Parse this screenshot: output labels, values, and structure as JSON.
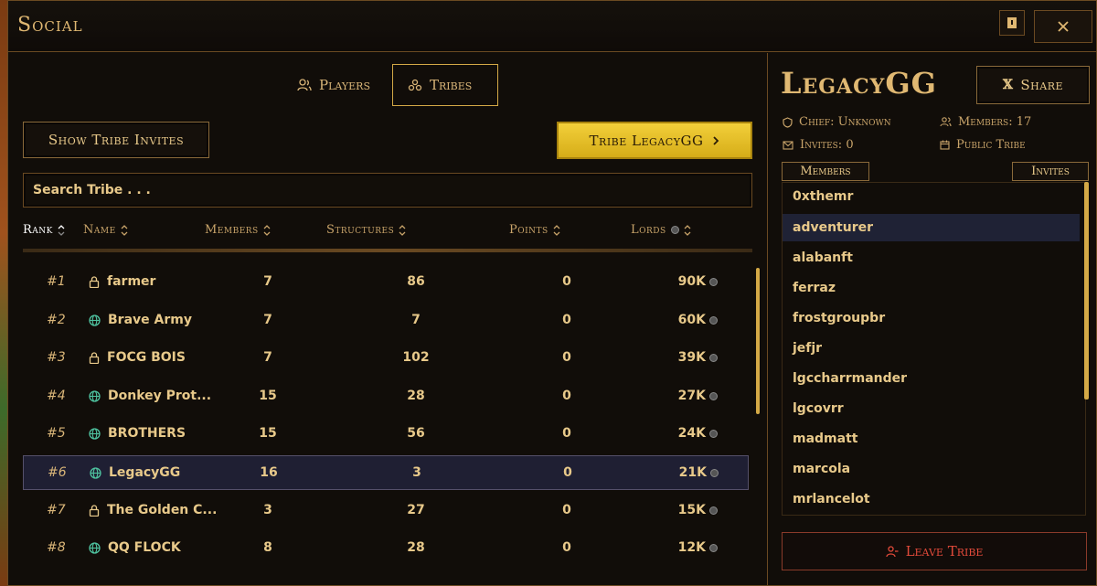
{
  "window": {
    "title": "Social"
  },
  "tabs": [
    {
      "label": "Players",
      "icon": "users-icon"
    },
    {
      "label": "Tribes",
      "icon": "tribes-icon",
      "active": true
    }
  ],
  "actions": {
    "show_invites": "Show Tribe Invites",
    "tribe_button": "Tribe LegacyGG",
    "search_placeholder": "Search Tribe . . ."
  },
  "table": {
    "columns": [
      "Rank",
      "Name",
      "Members",
      "Structures",
      "Points",
      "Lords"
    ],
    "sorted_by": "Rank",
    "rows": [
      {
        "rank": "#1",
        "name": "farmer",
        "visibility": "lock-icon",
        "members": "7",
        "structures": "86",
        "points": "0",
        "lords": "90K"
      },
      {
        "rank": "#2",
        "name": "Brave Army",
        "visibility": "globe-icon",
        "members": "7",
        "structures": "7",
        "points": "0",
        "lords": "60K"
      },
      {
        "rank": "#3",
        "name": "FOCG BOIS",
        "visibility": "lock-icon",
        "members": "7",
        "structures": "102",
        "points": "0",
        "lords": "39K"
      },
      {
        "rank": "#4",
        "name": "Donkey Prot...",
        "visibility": "globe-icon",
        "members": "15",
        "structures": "28",
        "points": "0",
        "lords": "27K"
      },
      {
        "rank": "#5",
        "name": "BROTHERS",
        "visibility": "globe-icon",
        "members": "15",
        "structures": "56",
        "points": "0",
        "lords": "24K"
      },
      {
        "rank": "#6",
        "name": "LegacyGG",
        "visibility": "globe-icon",
        "members": "16",
        "structures": "3",
        "points": "0",
        "lords": "21K",
        "selected": true
      },
      {
        "rank": "#7",
        "name": "The Golden C...",
        "visibility": "lock-icon",
        "members": "3",
        "structures": "27",
        "points": "0",
        "lords": "15K"
      },
      {
        "rank": "#8",
        "name": "QQ FLOCK",
        "visibility": "globe-icon",
        "members": "8",
        "structures": "28",
        "points": "0",
        "lords": "12K"
      }
    ]
  },
  "tribe": {
    "name": "LegacyGG",
    "share": "Share",
    "chief": "Chief: Unknown",
    "members_count": "Members: 17",
    "invites": "Invites: 0",
    "visibility": "Public Tribe",
    "tab_members": "Members",
    "tab_invites": "Invites",
    "members": [
      "0xthemr",
      "adventurer",
      "alabanft",
      "ferraz",
      "frostgroupbr",
      "jefjr",
      "lgccharrmander",
      "lgcovrr",
      "madmatt",
      "marcola",
      "mrlancelot"
    ],
    "highlighted_member": "adventurer",
    "leave": "Leave Tribe"
  },
  "colors": {
    "gold": "#e0b872",
    "accent_button": "#f2cf3a",
    "danger": "#e14a3a",
    "selected_row": "#1f1f33"
  }
}
